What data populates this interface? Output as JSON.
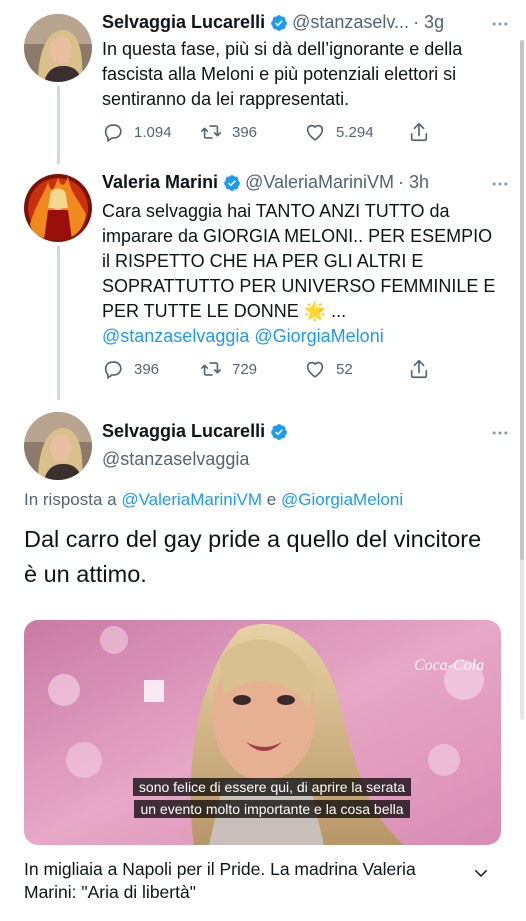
{
  "thread": [
    {
      "author": "Selvaggia Lucarelli",
      "handle": "@stanzaselv...",
      "time": "· 3g",
      "text": "In questa fase, più si dà dell’ignorante e della fascista alla Meloni e più potenziali elettori si sentiranno da lei rappresentati.",
      "replies": "1.094",
      "retweets": "396",
      "likes": "5.294",
      "verified": true
    },
    {
      "author": "Valeria Marini",
      "handle": "@ValeriaMariniVM",
      "time": "· 3h",
      "text": "Cara selvaggia hai TANTO ANZI TUTTO da imparare da GIORGIA MELONI.. PER ESEMPIO il RISPETTO CHE HA PER GLI ALTRI E SOPRATTUTTO  PER UNIVERSO FEMMINILE E PER TUTTE LE DONNE",
      "emoji": "🌟",
      "ellipsis": "...",
      "mention_1": "@stanzaselvaggia",
      "mention_2": "@GiorgiaMeloni",
      "replies": "396",
      "retweets": "729",
      "likes": "52",
      "verified": true
    }
  ],
  "main_tweet": {
    "author": "Selvaggia Lucarelli",
    "handle": "@stanzaselvaggia",
    "reply_prefix": "In risposta a",
    "reply_mention_1": "@ValeriaMariniVM",
    "reply_conjunction": "e",
    "reply_mention_2": "@GiorgiaMeloni",
    "text": "Dal carro del gay pride a quello del vincitore è un attimo.",
    "video": {
      "subtitle_line_1": "sono felice di essere qui, di aprire la serata",
      "subtitle_line_2": "un evento molto importante e la cosa bella",
      "backdrop_brand": "Coca-Cola"
    },
    "card_title": "In migliaia a Napoli per il Pride. La madrina Valeria Marini: \"Aria di libertà\""
  },
  "colors": {
    "accent": "#1d9bf0",
    "text": "#0f1419",
    "secondary": "#536471",
    "thread_line": "#cfd9de"
  },
  "icons": [
    "verified-badge-icon",
    "more-icon",
    "reply-icon",
    "retweet-icon",
    "like-icon",
    "share-icon",
    "chevron-down-icon"
  ]
}
